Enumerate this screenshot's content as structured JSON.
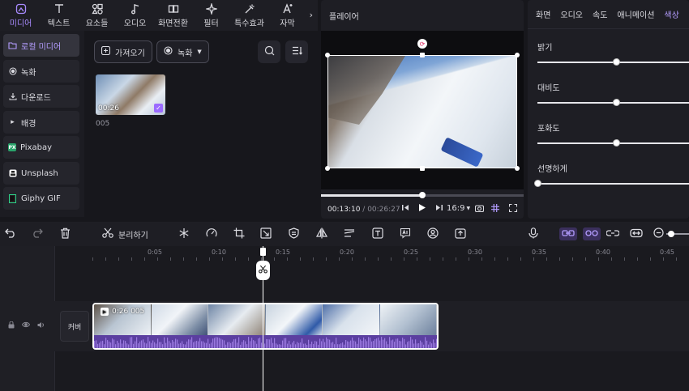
{
  "toolbar": {
    "tools": [
      {
        "label": "미디어",
        "icon": "media-icon"
      },
      {
        "label": "텍스트",
        "icon": "text-icon"
      },
      {
        "label": "요소들",
        "icon": "elements-icon"
      },
      {
        "label": "오디오",
        "icon": "audio-icon"
      },
      {
        "label": "화면전환",
        "icon": "transition-icon"
      },
      {
        "label": "필터",
        "icon": "filter-icon"
      },
      {
        "label": "특수효과",
        "icon": "effects-icon"
      },
      {
        "label": "자막",
        "icon": "caption-icon"
      }
    ],
    "more_glyph": "›"
  },
  "sidebar": {
    "items": [
      {
        "label": "로컬 미디어",
        "icon": "folder-icon"
      },
      {
        "label": "녹화",
        "icon": "record-icon"
      },
      {
        "label": "다운로드",
        "icon": "download-icon"
      },
      {
        "label": "배경",
        "icon": "triangle-right-icon"
      },
      {
        "label": "Pixabay",
        "icon": "pixabay-icon",
        "badge": "PX"
      },
      {
        "label": "Unsplash",
        "icon": "unsplash-icon"
      },
      {
        "label": "Giphy GIF",
        "icon": "giphy-icon"
      }
    ]
  },
  "media": {
    "import_label": "가져오기",
    "record_label": "녹화",
    "clip": {
      "duration": "00:26",
      "name": "005"
    }
  },
  "player": {
    "title": "플레이어",
    "current_time": "00:13:10",
    "total_time": "/ 00:26:27",
    "aspect": "16:9",
    "progress": 0.5
  },
  "properties": {
    "tabs": [
      "화면",
      "오디오",
      "속도",
      "애니메이션",
      "색상"
    ],
    "active_tab": 4,
    "sliders": [
      {
        "label": "밝기",
        "value": 0.52
      },
      {
        "label": "대비도",
        "value": 0.52
      },
      {
        "label": "포화도",
        "value": 0.52
      },
      {
        "label": "선명하게",
        "value": 0.0
      }
    ]
  },
  "timeline_toolbar": {
    "split_label": "분리하기"
  },
  "timeline": {
    "ticks": [
      "0:05",
      "0:10",
      "0:15",
      "0:20",
      "0:25",
      "0:30",
      "0:35",
      "0:40",
      "0:45"
    ],
    "cover_label": "커버",
    "clip_label": "0:26 005"
  },
  "colors": {
    "accent": "#b49dff",
    "audio": "#5b3fa0"
  }
}
